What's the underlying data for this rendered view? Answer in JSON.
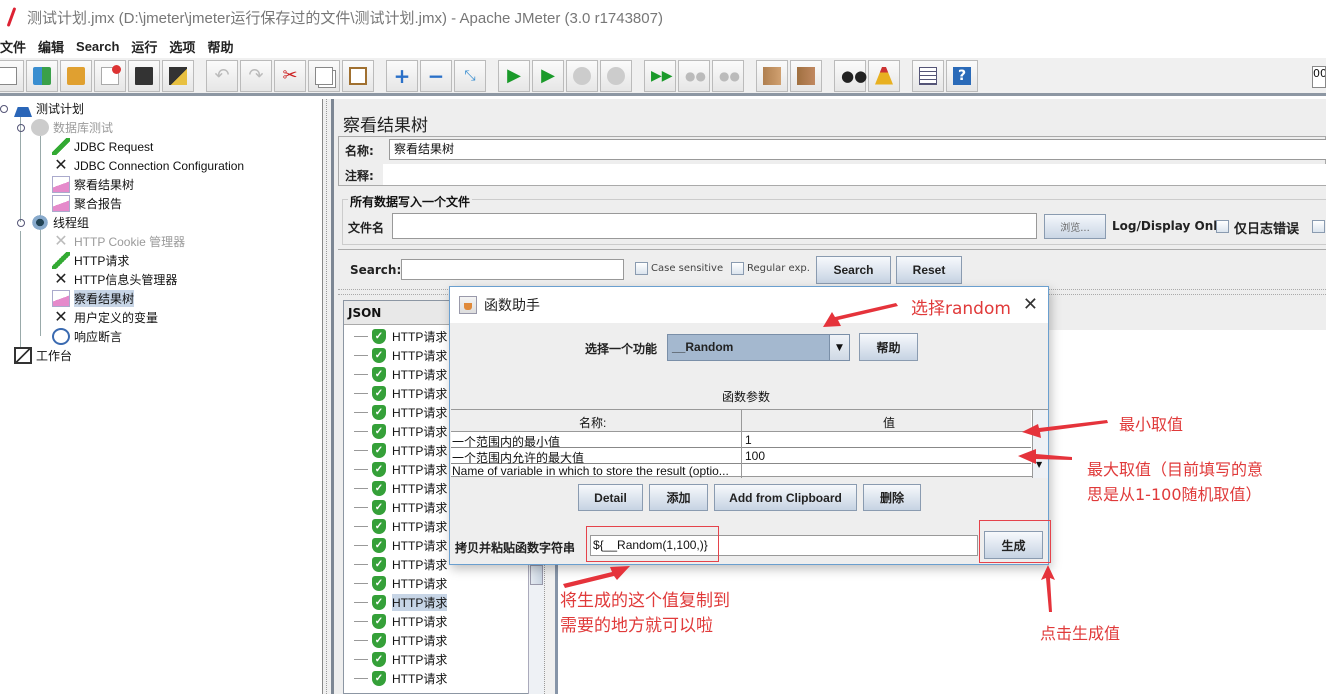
{
  "window": {
    "title": "测试计划.jmx (D:\\jmeter\\jmeter运行保存过的文件\\测试计划.jmx) - Apache JMeter (3.0 r1743807)"
  },
  "menubar": {
    "items": [
      "文件",
      "编辑",
      "Search",
      "运行",
      "选项",
      "帮助"
    ]
  },
  "toolbar": {
    "buttons": [
      {
        "icon": "new-icon"
      },
      {
        "icon": "templates-icon"
      },
      {
        "icon": "open-icon"
      },
      {
        "icon": "close-icon"
      },
      {
        "icon": "save-icon"
      },
      {
        "icon": "save-as-icon"
      },
      {
        "icon": "undo-icon"
      },
      {
        "icon": "redo-icon"
      },
      {
        "icon": "cut-icon"
      },
      {
        "icon": "copy-icon"
      },
      {
        "icon": "paste-icon"
      },
      {
        "icon": "expand-icon"
      },
      {
        "icon": "collapse-icon"
      },
      {
        "icon": "toggle-icon"
      },
      {
        "icon": "start-icon"
      },
      {
        "icon": "start-no-pause-icon"
      },
      {
        "icon": "stop-icon"
      },
      {
        "icon": "shutdown-icon"
      },
      {
        "icon": "remote-start-icon"
      },
      {
        "icon": "remote-stop-icon"
      },
      {
        "icon": "remote-shutdown-icon"
      },
      {
        "icon": "clear-icon"
      },
      {
        "icon": "clear-all-icon"
      },
      {
        "icon": "search-binoculars-icon"
      },
      {
        "icon": "reset-search-broom-icon"
      },
      {
        "icon": "function-helper-icon"
      },
      {
        "icon": "help-icon"
      }
    ],
    "counter_value": "00"
  },
  "tree": {
    "items": [
      {
        "label": "测试计划",
        "icon": "test-plan-icon",
        "level": 0,
        "disabled": false,
        "selected": false
      },
      {
        "label": "数据库测试",
        "icon": "thread-group-icon",
        "level": 1,
        "disabled": true,
        "selected": false
      },
      {
        "label": "JDBC Request",
        "icon": "sampler-icon",
        "level": 2,
        "disabled": false,
        "selected": false
      },
      {
        "label": "JDBC Connection Configuration",
        "icon": "config-icon",
        "level": 2,
        "disabled": false,
        "selected": false
      },
      {
        "label": "察看结果树",
        "icon": "listener-icon",
        "level": 2,
        "disabled": false,
        "selected": false
      },
      {
        "label": "聚合报告",
        "icon": "listener-icon",
        "level": 2,
        "disabled": false,
        "selected": false
      },
      {
        "label": "线程组",
        "icon": "thread-group-icon",
        "level": 1,
        "disabled": false,
        "selected": false
      },
      {
        "label": "HTTP Cookie 管理器",
        "icon": "config-icon",
        "level": 2,
        "disabled": true,
        "selected": false
      },
      {
        "label": "HTTP请求",
        "icon": "sampler-icon",
        "level": 2,
        "disabled": false,
        "selected": false
      },
      {
        "label": "HTTP信息头管理器",
        "icon": "config-icon",
        "level": 2,
        "disabled": false,
        "selected": false
      },
      {
        "label": "察看结果树",
        "icon": "listener-icon",
        "level": 2,
        "disabled": false,
        "selected": true
      },
      {
        "label": "用户定义的变量",
        "icon": "config-icon",
        "level": 2,
        "disabled": false,
        "selected": false
      },
      {
        "label": "响应断言",
        "icon": "assertion-icon",
        "level": 2,
        "disabled": false,
        "selected": false
      },
      {
        "label": "工作台",
        "icon": "workbench-icon",
        "level": 0,
        "disabled": false,
        "selected": false
      }
    ]
  },
  "panel": {
    "title": "察看结果树",
    "name_label": "名称:",
    "name_value": "察看结果树",
    "comment_label": "注释:",
    "comment_value": "",
    "file_group_title": "所有数据写入一个文件",
    "filename_label": "文件名",
    "filename_value": "",
    "browse_label": "浏览...",
    "log_display_label": "Log/Display Only:",
    "errors_only_label": "仅日志错误",
    "search_label": "Search:",
    "search_value": "",
    "case_sensitive_label": "Case sensitive",
    "regex_label": "Regular exp.",
    "search_button": "Search",
    "reset_button": "Reset",
    "results_header": "JSON",
    "result_items": [
      "HTTP请求",
      "HTTP请求",
      "HTTP请求",
      "HTTP请求",
      "HTTP请求",
      "HTTP请求",
      "HTTP请求",
      "HTTP请求",
      "HTTP请求",
      "HTTP请求",
      "HTTP请求",
      "HTTP请求",
      "HTTP请求",
      "HTTP请求",
      "HTTP请求",
      "HTTP请求",
      "HTTP请求",
      "HTTP请求",
      "HTTP请求"
    ],
    "selected_result_index": 14
  },
  "dialog": {
    "title": "函数助手",
    "close": "✕",
    "select_label": "选择一个功能",
    "selected_function": "__Random",
    "help_button": "帮助",
    "params_title": "函数参数",
    "table": {
      "headers": [
        "名称:",
        "值"
      ],
      "rows": [
        {
          "name": "一个范围内的最小值",
          "value": "1"
        },
        {
          "name": "一个范围内允许的最大值",
          "value": "100"
        },
        {
          "name": "Name of variable in which to store the result (optio...",
          "value": ""
        }
      ]
    },
    "buttons": [
      "Detail",
      "添加",
      "Add from Clipboard",
      "删除"
    ],
    "output_label": "拷贝并粘贴函数字符串",
    "output_value": "${__Random(1,100,)}",
    "generate_button": "生成"
  },
  "annotations": {
    "select_random": "选择random",
    "min_value": "最小取值",
    "max_value_line1": "最大取值（目前填写的意",
    "max_value_line2": "思是从1-100随机取值）",
    "copy_line1": "将生成的这个值复制到",
    "copy_line2": "需要的地方就可以啦",
    "click_generate": "点击生成值",
    "color": "#e03a3a"
  }
}
